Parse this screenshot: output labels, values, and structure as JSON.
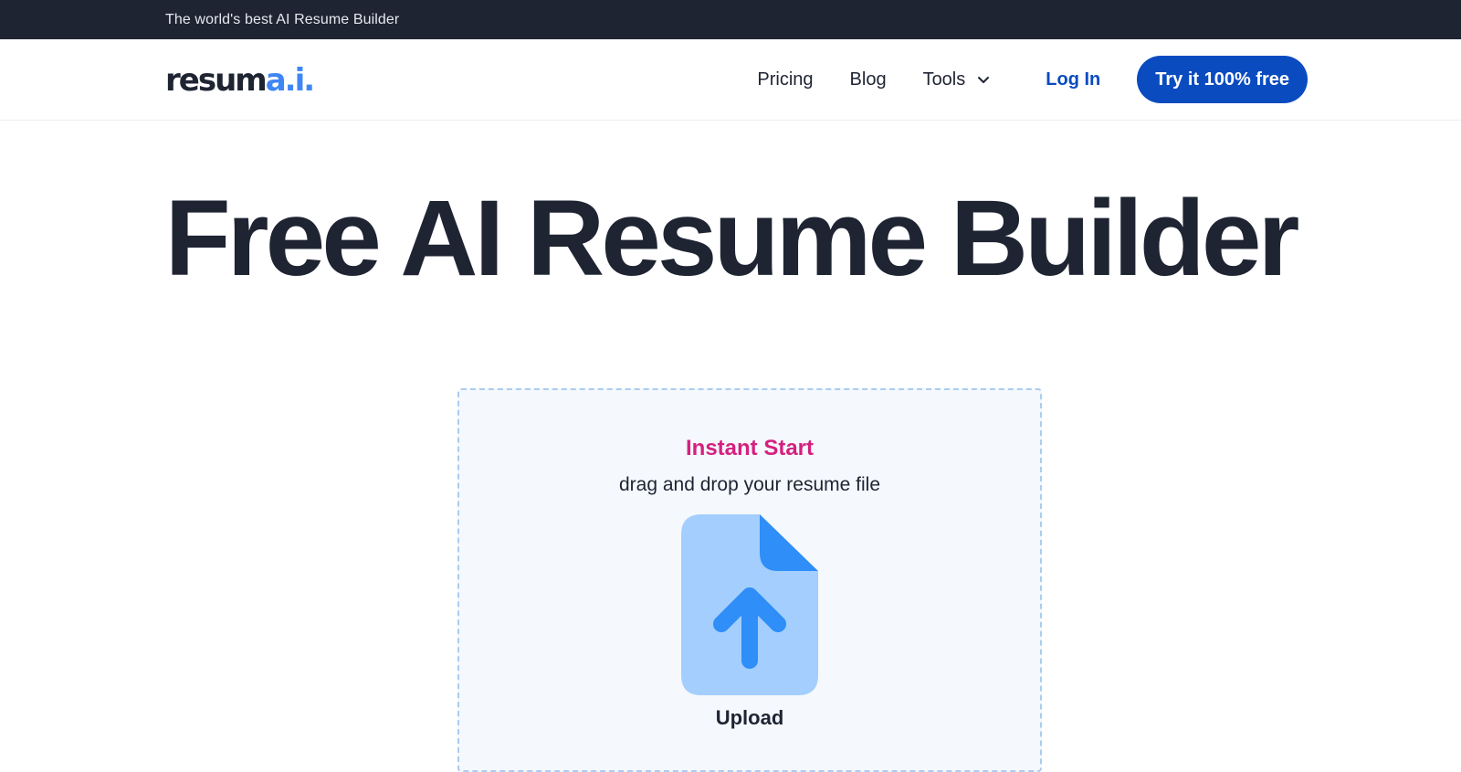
{
  "topbar": {
    "tagline": "The world's best AI Resume Builder"
  },
  "nav": {
    "logo": {
      "main": "resum",
      "accent": "a.i."
    },
    "links": [
      {
        "label": "Pricing"
      },
      {
        "label": "Blog"
      },
      {
        "label": "Tools",
        "icon": "chevron-down-icon"
      }
    ],
    "login_label": "Log In",
    "cta_label": "Try it 100% free"
  },
  "hero": {
    "title": "Free AI Resume Builder"
  },
  "dropzone": {
    "title": "Instant Start",
    "subtitle": "drag and drop your resume file",
    "icon": "file-upload-icon",
    "label": "Upload"
  },
  "colors": {
    "dark": "#1f2433",
    "brand_blue": "#0a4bc0",
    "logo_accent": "#3f86f5",
    "instant_start": "#d5207f",
    "dropzone_bg": "#f5f8fd",
    "dropzone_border": "#a9cdf0",
    "icon_light": "#a3cefd",
    "icon_dark": "#2f8ef7"
  }
}
